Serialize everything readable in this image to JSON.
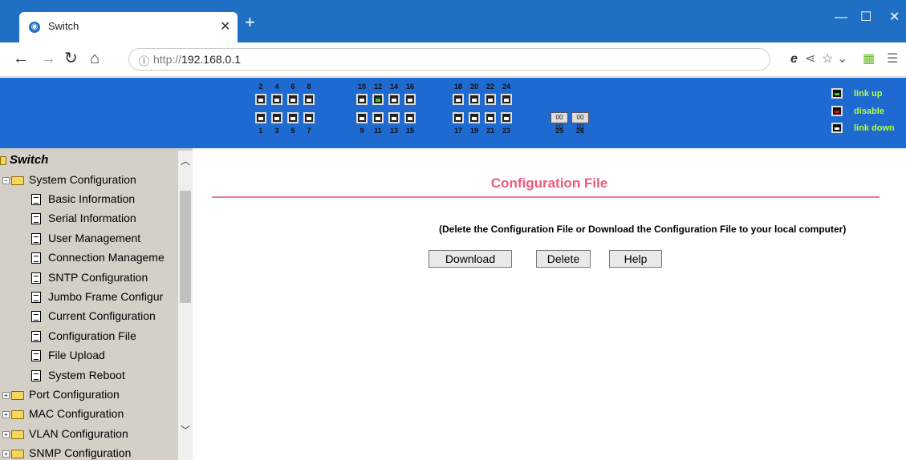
{
  "browser": {
    "tab_title": "Switch",
    "url_prefix": "http://",
    "url_host": "192.168.0.1"
  },
  "banner": {
    "top_numbers": [
      "2",
      "4",
      "6",
      "8",
      "10",
      "12",
      "14",
      "16",
      "18",
      "20",
      "22",
      "24"
    ],
    "bottom_numbers": [
      "1",
      "3",
      "5",
      "7",
      "9",
      "11",
      "13",
      "15",
      "17",
      "19",
      "21",
      "23"
    ],
    "sfp_numbers": [
      "25",
      "26"
    ],
    "sfp_glyph": "00 00",
    "port_up": "12",
    "legend": {
      "up": "link up",
      "disable": "disable",
      "down": "link down"
    },
    "colors": {
      "up": "#2bd52b",
      "disable": "#e01010",
      "down": "#ffffff"
    }
  },
  "sidebar": {
    "root": "Switch",
    "system_configuration": "System Configuration",
    "items": [
      "Basic Information",
      "Serial Information",
      "User Management",
      "Connection Manageme",
      "SNTP Configuration",
      "Jumbo Frame Configur",
      "Current Configuration",
      "Configuration File",
      "File Upload",
      "System Reboot"
    ],
    "folders": [
      "Port Configuration",
      "MAC Configuration",
      "VLAN Configuration",
      "SNMP Configuration"
    ]
  },
  "content": {
    "title": "Configuration File",
    "description": "(Delete the Configuration File or Download the Configuration File to your local computer)",
    "buttons": {
      "download": "Download",
      "delete": "Delete",
      "help": "Help"
    }
  }
}
